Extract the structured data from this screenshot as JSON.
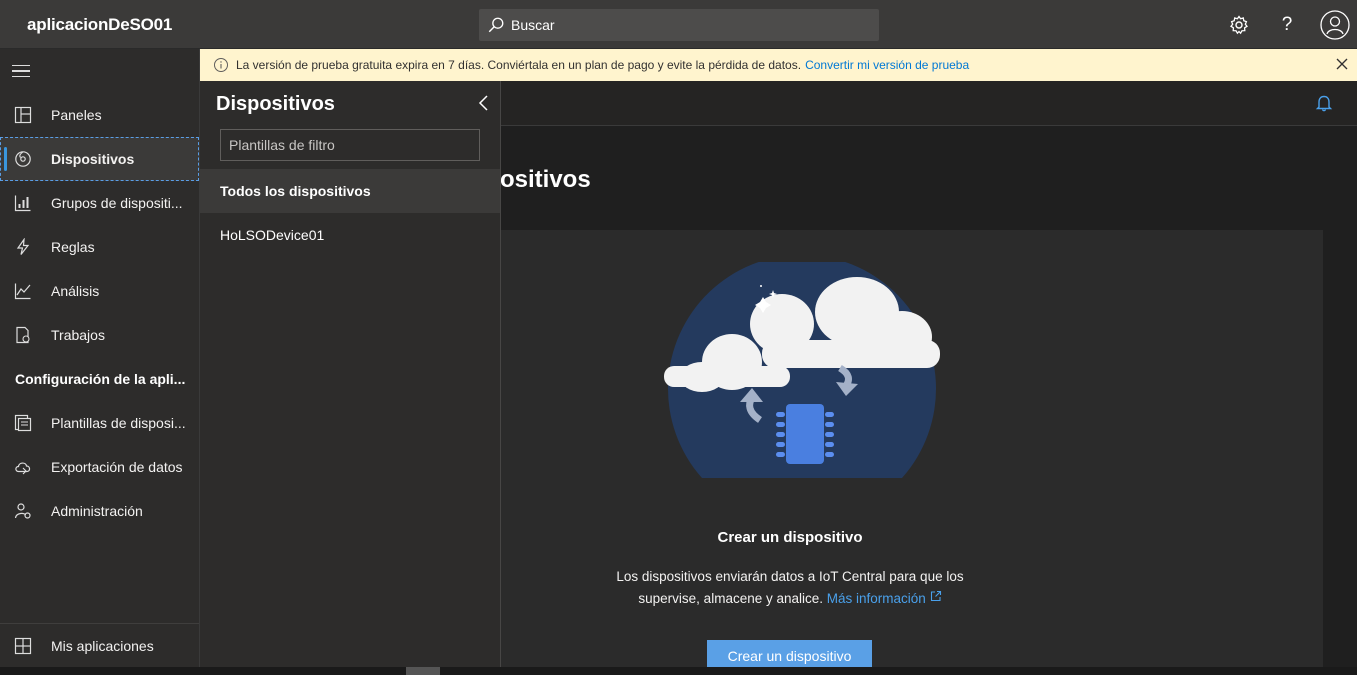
{
  "app": {
    "title": "aplicacionDeSO01"
  },
  "search": {
    "label": "Buscar"
  },
  "banner": {
    "message": "La versión de prueba gratuita expira en 7 días. Conviértala en un plan de pago y evite la pérdida de datos.",
    "link": "Convertir mi versión de prueba",
    "bg_color": "#fff4ce"
  },
  "topbar": {
    "help_label": "?"
  },
  "sidebar": {
    "items": [
      {
        "label": "Paneles",
        "icon": "dashboard-icon"
      },
      {
        "label": "Dispositivos",
        "icon": "devices-icon"
      },
      {
        "label": "Grupos de dispositi...",
        "icon": "device-groups-icon"
      },
      {
        "label": "Reglas",
        "icon": "rules-icon"
      },
      {
        "label": "Análisis",
        "icon": "analytics-icon"
      },
      {
        "label": "Trabajos",
        "icon": "jobs-icon"
      }
    ],
    "section_label": "Configuración de la apli...",
    "config_items": [
      {
        "label": "Plantillas de disposi...",
        "icon": "device-templates-icon"
      },
      {
        "label": "Exportación de datos",
        "icon": "data-export-icon"
      },
      {
        "label": "Administración",
        "icon": "administration-icon"
      }
    ],
    "bottom_item": {
      "label": "Mis aplicaciones",
      "icon": "my-apps-icon"
    }
  },
  "flyout": {
    "title": "Dispositivos",
    "filter_placeholder": "Plantillas de filtro",
    "rows": [
      {
        "label": "Todos los dispositivos",
        "selected": true
      },
      {
        "label": "HoLSODevice01",
        "selected": false
      }
    ]
  },
  "main": {
    "page_title": "ositivos",
    "empty_title": "Crear un dispositivo",
    "empty_desc_line1": "Los dispositivos enviarán datos a IoT Central para que los",
    "empty_desc_line2": "supervise, almacene y analice.",
    "more_info": "Más información",
    "cta": "Crear un dispositivo",
    "accent_color": "#5aa0e6"
  }
}
